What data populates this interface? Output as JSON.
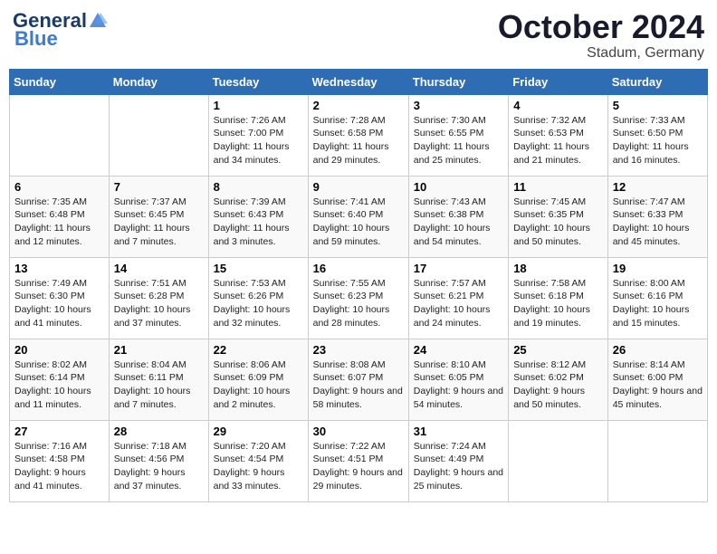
{
  "header": {
    "logo_general": "General",
    "logo_blue": "Blue",
    "month": "October 2024",
    "location": "Stadum, Germany"
  },
  "days_of_week": [
    "Sunday",
    "Monday",
    "Tuesday",
    "Wednesday",
    "Thursday",
    "Friday",
    "Saturday"
  ],
  "weeks": [
    [
      {
        "num": "",
        "info": ""
      },
      {
        "num": "",
        "info": ""
      },
      {
        "num": "1",
        "info": "Sunrise: 7:26 AM\nSunset: 7:00 PM\nDaylight: 11 hours and 34 minutes."
      },
      {
        "num": "2",
        "info": "Sunrise: 7:28 AM\nSunset: 6:58 PM\nDaylight: 11 hours and 29 minutes."
      },
      {
        "num": "3",
        "info": "Sunrise: 7:30 AM\nSunset: 6:55 PM\nDaylight: 11 hours and 25 minutes."
      },
      {
        "num": "4",
        "info": "Sunrise: 7:32 AM\nSunset: 6:53 PM\nDaylight: 11 hours and 21 minutes."
      },
      {
        "num": "5",
        "info": "Sunrise: 7:33 AM\nSunset: 6:50 PM\nDaylight: 11 hours and 16 minutes."
      }
    ],
    [
      {
        "num": "6",
        "info": "Sunrise: 7:35 AM\nSunset: 6:48 PM\nDaylight: 11 hours and 12 minutes."
      },
      {
        "num": "7",
        "info": "Sunrise: 7:37 AM\nSunset: 6:45 PM\nDaylight: 11 hours and 7 minutes."
      },
      {
        "num": "8",
        "info": "Sunrise: 7:39 AM\nSunset: 6:43 PM\nDaylight: 11 hours and 3 minutes."
      },
      {
        "num": "9",
        "info": "Sunrise: 7:41 AM\nSunset: 6:40 PM\nDaylight: 10 hours and 59 minutes."
      },
      {
        "num": "10",
        "info": "Sunrise: 7:43 AM\nSunset: 6:38 PM\nDaylight: 10 hours and 54 minutes."
      },
      {
        "num": "11",
        "info": "Sunrise: 7:45 AM\nSunset: 6:35 PM\nDaylight: 10 hours and 50 minutes."
      },
      {
        "num": "12",
        "info": "Sunrise: 7:47 AM\nSunset: 6:33 PM\nDaylight: 10 hours and 45 minutes."
      }
    ],
    [
      {
        "num": "13",
        "info": "Sunrise: 7:49 AM\nSunset: 6:30 PM\nDaylight: 10 hours and 41 minutes."
      },
      {
        "num": "14",
        "info": "Sunrise: 7:51 AM\nSunset: 6:28 PM\nDaylight: 10 hours and 37 minutes."
      },
      {
        "num": "15",
        "info": "Sunrise: 7:53 AM\nSunset: 6:26 PM\nDaylight: 10 hours and 32 minutes."
      },
      {
        "num": "16",
        "info": "Sunrise: 7:55 AM\nSunset: 6:23 PM\nDaylight: 10 hours and 28 minutes."
      },
      {
        "num": "17",
        "info": "Sunrise: 7:57 AM\nSunset: 6:21 PM\nDaylight: 10 hours and 24 minutes."
      },
      {
        "num": "18",
        "info": "Sunrise: 7:58 AM\nSunset: 6:18 PM\nDaylight: 10 hours and 19 minutes."
      },
      {
        "num": "19",
        "info": "Sunrise: 8:00 AM\nSunset: 6:16 PM\nDaylight: 10 hours and 15 minutes."
      }
    ],
    [
      {
        "num": "20",
        "info": "Sunrise: 8:02 AM\nSunset: 6:14 PM\nDaylight: 10 hours and 11 minutes."
      },
      {
        "num": "21",
        "info": "Sunrise: 8:04 AM\nSunset: 6:11 PM\nDaylight: 10 hours and 7 minutes."
      },
      {
        "num": "22",
        "info": "Sunrise: 8:06 AM\nSunset: 6:09 PM\nDaylight: 10 hours and 2 minutes."
      },
      {
        "num": "23",
        "info": "Sunrise: 8:08 AM\nSunset: 6:07 PM\nDaylight: 9 hours and 58 minutes."
      },
      {
        "num": "24",
        "info": "Sunrise: 8:10 AM\nSunset: 6:05 PM\nDaylight: 9 hours and 54 minutes."
      },
      {
        "num": "25",
        "info": "Sunrise: 8:12 AM\nSunset: 6:02 PM\nDaylight: 9 hours and 50 minutes."
      },
      {
        "num": "26",
        "info": "Sunrise: 8:14 AM\nSunset: 6:00 PM\nDaylight: 9 hours and 45 minutes."
      }
    ],
    [
      {
        "num": "27",
        "info": "Sunrise: 7:16 AM\nSunset: 4:58 PM\nDaylight: 9 hours and 41 minutes."
      },
      {
        "num": "28",
        "info": "Sunrise: 7:18 AM\nSunset: 4:56 PM\nDaylight: 9 hours and 37 minutes."
      },
      {
        "num": "29",
        "info": "Sunrise: 7:20 AM\nSunset: 4:54 PM\nDaylight: 9 hours and 33 minutes."
      },
      {
        "num": "30",
        "info": "Sunrise: 7:22 AM\nSunset: 4:51 PM\nDaylight: 9 hours and 29 minutes."
      },
      {
        "num": "31",
        "info": "Sunrise: 7:24 AM\nSunset: 4:49 PM\nDaylight: 9 hours and 25 minutes."
      },
      {
        "num": "",
        "info": ""
      },
      {
        "num": "",
        "info": ""
      }
    ]
  ]
}
